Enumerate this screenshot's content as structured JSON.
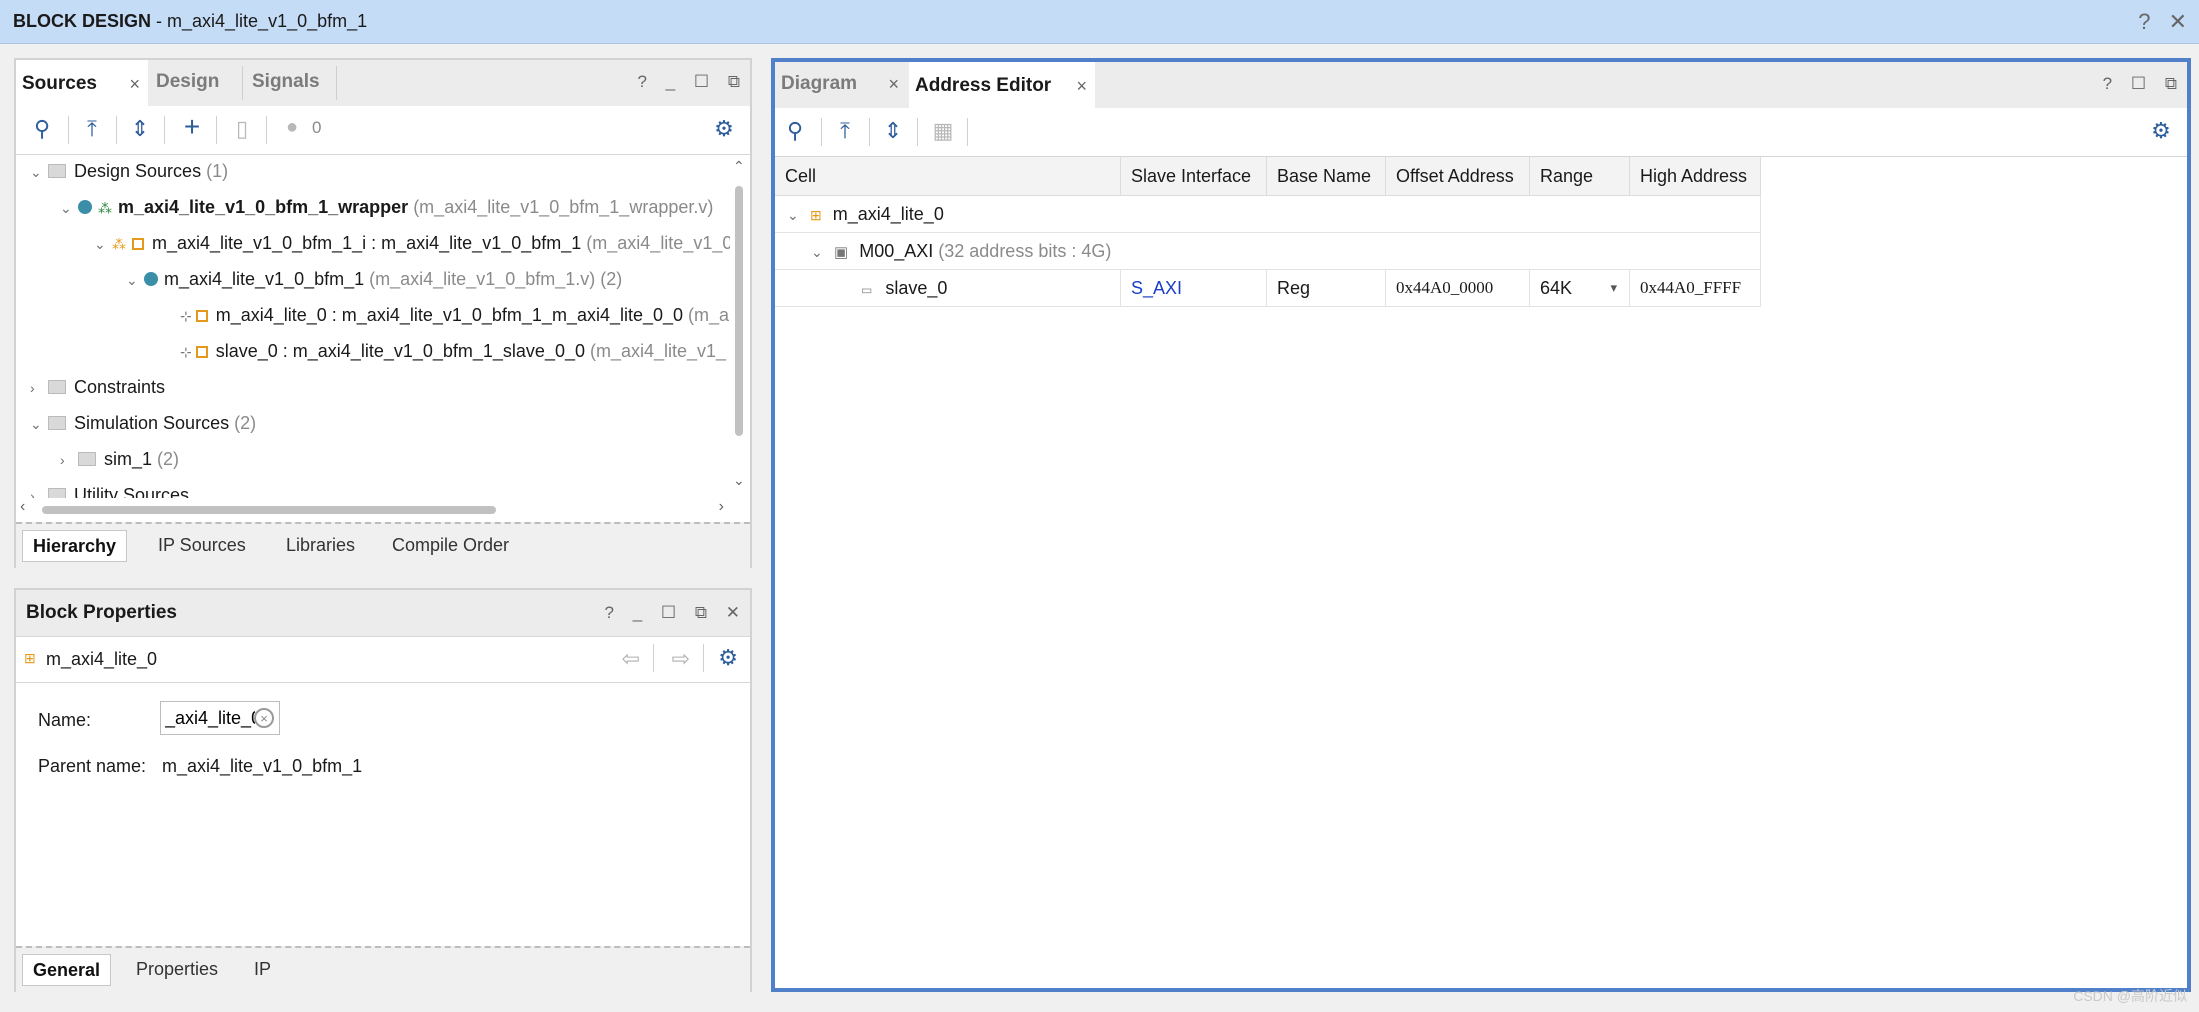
{
  "window": {
    "title_bold": "BLOCK DESIGN",
    "title_rest": " - m_axi4_lite_v1_0_bfm_1",
    "help": "?",
    "close": "✕"
  },
  "sources": {
    "tabs": [
      {
        "label": "Sources",
        "selected": true
      },
      {
        "label": "Design",
        "selected": false
      },
      {
        "label": "Signals",
        "selected": false
      }
    ],
    "tab_close": "×",
    "win_icons": {
      "help": "?",
      "min": "_",
      "max": "☐",
      "float": "⧉"
    },
    "toolbar": {
      "search": "⚲",
      "collapse": "⤒",
      "expand": "⇕",
      "add": "+",
      "dim": "▯",
      "count": "0",
      "gear": "⚙"
    },
    "tree": [
      {
        "indent": 0,
        "chev": "⌄",
        "icon": "folder",
        "text": "Design Sources",
        "gray": " (1)",
        "bold": false
      },
      {
        "indent": 1,
        "chev": "⌄",
        "icon": "dot-green",
        "text": "m_axi4_lite_v1_0_bfm_1_wrapper",
        "gray": " (m_axi4_lite_v1_0_bfm_1_wrapper.v)",
        "bold": true
      },
      {
        "indent": 2,
        "chev": "⌄",
        "icon": "orange",
        "text": "m_axi4_lite_v1_0_bfm_1_i : m_axi4_lite_v1_0_bfm_1",
        "gray": " (m_axi4_lite_v1_0",
        "bold": false
      },
      {
        "indent": 3,
        "chev": "⌄",
        "icon": "dot",
        "text": "m_axi4_lite_v1_0_bfm_1",
        "gray": " (m_axi4_lite_v1_0_bfm_1.v) (2)",
        "bold": false
      },
      {
        "indent": 4,
        "chev": "",
        "icon": "pin",
        "text": "m_axi4_lite_0 : m_axi4_lite_v1_0_bfm_1_m_axi4_lite_0_0",
        "gray": " (m_a",
        "bold": false
      },
      {
        "indent": 4,
        "chev": "",
        "icon": "pin",
        "text": "slave_0 : m_axi4_lite_v1_0_bfm_1_slave_0_0",
        "gray": " (m_axi4_lite_v1_",
        "bold": false
      },
      {
        "indent": 0,
        "chev": "›",
        "icon": "folder",
        "text": "Constraints",
        "gray": "",
        "bold": false
      },
      {
        "indent": 0,
        "chev": "⌄",
        "icon": "folder",
        "text": "Simulation Sources",
        "gray": " (2)",
        "bold": false
      },
      {
        "indent": 1,
        "chev": "›",
        "icon": "folder",
        "text": "sim_1",
        "gray": " (2)",
        "bold": false
      },
      {
        "indent": 0,
        "chev": "›",
        "icon": "folder",
        "text": "Utility Sources",
        "gray": "",
        "bold": false
      }
    ],
    "bottom_tabs": [
      "Hierarchy",
      "IP Sources",
      "Libraries",
      "Compile Order"
    ]
  },
  "block_properties": {
    "title": "Block Properties",
    "win_icons": {
      "help": "?",
      "min": "_",
      "max": "☐",
      "float": "⧉",
      "close": "✕"
    },
    "object": "m_axi4_lite_0",
    "back": "⇦",
    "forward": "⇨",
    "gear": "⚙",
    "name_label": "Name:",
    "name_value": "_axi4_lite_0",
    "clear": "×",
    "parent_label": "Parent name:",
    "parent_value": "m_axi4_lite_v1_0_bfm_1",
    "bottom_tabs": [
      "General",
      "Properties",
      "IP"
    ]
  },
  "right": {
    "tabs": [
      {
        "label": "Diagram",
        "selected": false
      },
      {
        "label": "Address Editor",
        "selected": true
      }
    ],
    "tab_close": "×",
    "win_icons": {
      "help": "?",
      "max": "☐",
      "float": "⧉"
    },
    "toolbar": {
      "search": "⚲",
      "collapse": "⤒",
      "expand": "⇕",
      "auto": "▦",
      "gear": "⚙"
    },
    "columns": [
      "Cell",
      "Slave Interface",
      "Base Name",
      "Offset Address",
      "Range",
      "High Address"
    ],
    "rows": [
      {
        "chev": "⌄",
        "cell": "m_axi4_lite_0",
        "gray": "",
        "slave": "",
        "base": "",
        "offset": "",
        "range": "",
        "high": ""
      },
      {
        "chev": "⌄",
        "cell": "M00_AXI",
        "gray": " (32 address bits : 4G)",
        "slave": "",
        "base": "",
        "offset": "",
        "range": "",
        "high": ""
      },
      {
        "chev": "",
        "cell": "slave_0",
        "gray": "",
        "slave": "S_AXI",
        "base": "Reg",
        "offset": "0x44A0_0000",
        "range": "64K",
        "high": "0x44A0_FFFF"
      }
    ],
    "range_dropdown": "▾"
  },
  "watermark": "CSDN @高阶近似"
}
